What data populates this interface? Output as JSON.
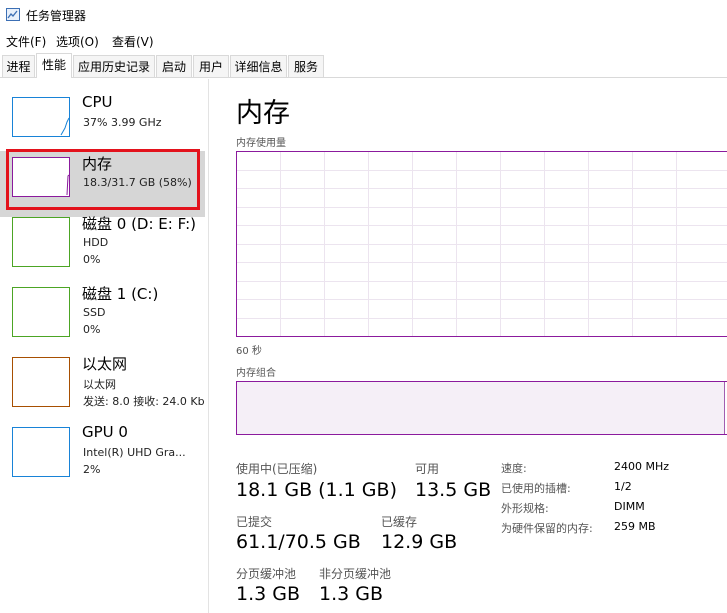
{
  "window": {
    "title": "任务管理器",
    "icon": "task-manager-icon"
  },
  "menu": [
    "文件(F)",
    "选项(O)",
    "查看(V)"
  ],
  "tabs": [
    "进程",
    "性能",
    "应用历史记录",
    "启动",
    "用户",
    "详细信息",
    "服务"
  ],
  "active_tab": "性能",
  "colors": {
    "cpu": "#1883d7",
    "memory": "#8b1a9d",
    "disk": "#4ca524",
    "ethernet": "#a74f01",
    "gpu": "#1883d7",
    "highlight": "#e3121c"
  },
  "sidebar": [
    {
      "name": "CPU",
      "line1": "37%  3.99 GHz",
      "line2": "",
      "line3": ""
    },
    {
      "name": "内存",
      "line1": "18.3/31.7 GB (58%)",
      "line2": "",
      "line3": ""
    },
    {
      "name": "磁盘 0 (D: E: F:)",
      "line1": "HDD",
      "line2": "0%",
      "line3": ""
    },
    {
      "name": "磁盘 1 (C:)",
      "line1": "SSD",
      "line2": "0%",
      "line3": ""
    },
    {
      "name": "以太网",
      "line1": "以太网",
      "line2": "发送: 8.0  接收: 24.0 Kb",
      "line3": ""
    },
    {
      "name": "GPU 0",
      "line1": "Intel(R) UHD Gra...",
      "line2": "2%",
      "line3": ""
    }
  ],
  "main": {
    "title": "内存",
    "usage_label": "内存使用量",
    "time_label": "60 秒",
    "composition_label": "内存组合",
    "in_use_label": "使用中(已压缩)",
    "in_use_value": "18.1 GB (1.1 GB)",
    "available_label": "可用",
    "available_value": "13.5 GB",
    "committed_label": "已提交",
    "committed_value": "61.1/70.5 GB",
    "cached_label": "已缓存",
    "cached_value": "12.9 GB",
    "paged_pool_label": "分页缓冲池",
    "paged_pool_value": "1.3 GB",
    "nonpaged_pool_label": "非分页缓冲池",
    "nonpaged_pool_value": "1.3 GB",
    "speed_label": "速度:",
    "speed_value": "2400 MHz",
    "slots_label": "已使用的插槽:",
    "slots_value": "1/2",
    "form_factor_label": "外形规格:",
    "form_factor_value": "DIMM",
    "reserved_label": "为硬件保留的内存:",
    "reserved_value": "259 MB"
  }
}
